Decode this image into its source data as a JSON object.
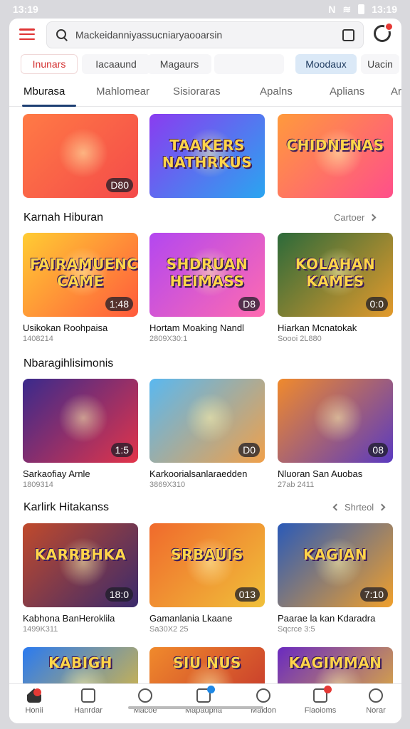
{
  "status": {
    "time": "13:19",
    "right_time": "13:19",
    "network": "N"
  },
  "search": {
    "value": "Mackeidanniyassucniaryaooarsin"
  },
  "chips": [
    "Inunars",
    "Iacaaund",
    "Magaurs",
    "",
    "Moodaux",
    "Uacin"
  ],
  "tabs": [
    "Mburasa",
    "Mahlomear",
    "Sisioraras",
    "Apalns",
    "Aplians",
    "Ar"
  ],
  "sections": [
    {
      "title": "",
      "more": "",
      "cards": [
        {
          "word": "",
          "dur": "D80",
          "title": "",
          "meta": "",
          "bg": [
            "#ff7a45",
            "#f44a4a"
          ]
        },
        {
          "word": "TAAKERS NATHRKUS",
          "dur": "",
          "title": "",
          "meta": "",
          "bg": [
            "#8a3cf0",
            "#2aa5f0"
          ]
        },
        {
          "word": "CHIDNENAS",
          "dur": "",
          "title": "",
          "meta": "",
          "bg": [
            "#ff9a3c",
            "#ff4f8a"
          ]
        }
      ]
    },
    {
      "title": "Karnah Hiburan",
      "more": "Cartoer",
      "cards": [
        {
          "word": "FAIRAMUENCING CAME",
          "dur": "1:48",
          "title": "Usikokan Roohpaisa",
          "meta": "1408214",
          "bg": [
            "#ffcc33",
            "#ff5a3c"
          ]
        },
        {
          "word": "SHDRUAN HEIMASS",
          "dur": "D8",
          "title": "Hortam Moaking Nandl",
          "meta": "2809X30:1",
          "bg": [
            "#b347f0",
            "#ff6bb0"
          ]
        },
        {
          "word": "KOLAHAN KAMES",
          "dur": "0:0",
          "title": "Hiarkan Mcnatokak",
          "meta": "Soooi 2L880",
          "bg": [
            "#2c6a3a",
            "#e39a2c"
          ]
        }
      ]
    },
    {
      "title": "Nbaragihlisimonis",
      "more": "",
      "cards": [
        {
          "word": "",
          "dur": "1:5",
          "title": "Sarkaofiay Arnle",
          "meta": "1809314",
          "bg": [
            "#3a2a8c",
            "#e2344a"
          ]
        },
        {
          "word": "",
          "dur": "D0",
          "title": "Karkoorialsanlaraedden",
          "meta": "3869X310",
          "bg": [
            "#5ab8f0",
            "#f0a04a"
          ]
        },
        {
          "word": "",
          "dur": "08",
          "title": "Nluoran San Auobas",
          "meta": "27ab 2411",
          "bg": [
            "#f08a2c",
            "#5a3ac0"
          ]
        }
      ]
    },
    {
      "title": "Karlirk Hitakanss",
      "more": "Shrteol",
      "cards": [
        {
          "word": "KARRBHKA",
          "dur": "18:0",
          "title": "Kabhona BanHeroklila",
          "meta": "1499K311",
          "bg": [
            "#c04a2c",
            "#3a2a6c"
          ]
        },
        {
          "word": "SRBAUIS",
          "dur": "013",
          "title": "Gamanlania Lkaane",
          "meta": "Sa30X2 25",
          "bg": [
            "#f06a2c",
            "#f0c03a"
          ]
        },
        {
          "word": "KAGIAN",
          "dur": "7:10",
          "title": "Paarae la kan Kdaradra",
          "meta": "Sqcrce 3:5",
          "bg": [
            "#2a5ab8",
            "#f0a02c"
          ]
        }
      ]
    },
    {
      "title": "",
      "more": "",
      "cards": [
        {
          "word": "KABIGH",
          "dur": "",
          "title": "",
          "meta": "",
          "bg": [
            "#2a7af0",
            "#f0c02c"
          ]
        },
        {
          "word": "SIU NUS",
          "dur": "",
          "title": "",
          "meta": "",
          "bg": [
            "#f08a2c",
            "#c02c2c"
          ]
        },
        {
          "word": "KAGIMMAN",
          "dur": "",
          "title": "",
          "meta": "",
          "bg": [
            "#6a2ac0",
            "#f0c02c"
          ]
        }
      ]
    }
  ],
  "nav": [
    {
      "label": "Honii",
      "icon": "home-icon",
      "badge": "#e53935"
    },
    {
      "label": "Hanrdar",
      "icon": "bag-icon",
      "badge": ""
    },
    {
      "label": "Macoe",
      "icon": "search-icon",
      "badge": ""
    },
    {
      "label": "Mapaupha",
      "icon": "document-icon",
      "badge": "#1e88e5"
    },
    {
      "label": "Maidon",
      "icon": "clock-icon",
      "badge": ""
    },
    {
      "label": "Flaoioms",
      "icon": "comment-icon",
      "badge": "#e53935"
    },
    {
      "label": "Norar",
      "icon": "user-icon",
      "badge": ""
    }
  ]
}
